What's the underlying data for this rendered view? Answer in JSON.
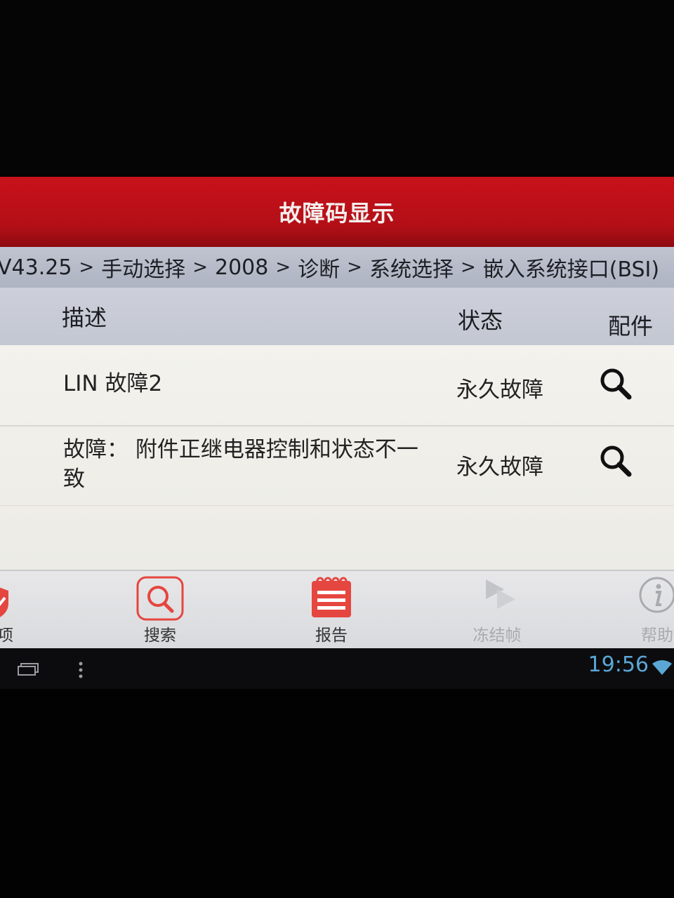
{
  "app": {
    "title": "故障码显示"
  },
  "breadcrumb": [
    "V43.25",
    "手动选择",
    "2008",
    "诊断",
    "系统选择",
    "嵌入系统接口(BSI)"
  ],
  "breadcrumb_separator": ">",
  "table": {
    "headers": {
      "description": "描述",
      "status": "状态",
      "part": "配件"
    },
    "rows": [
      {
        "description": "LIN 故障2",
        "status": "永久故障",
        "part_icon": "search-icon"
      },
      {
        "description": "故障： 附件正继电器控制和状态不一致",
        "status": "永久故障",
        "part_icon": "search-icon"
      }
    ]
  },
  "toolbar": {
    "partial_label": "项",
    "search_label": "搜索",
    "report_label": "报告",
    "freeze_frame_label": "冻结帧",
    "help_label": "帮助"
  },
  "system_bar": {
    "time": "19:56"
  },
  "colors": {
    "title_bar": "#b30f17",
    "accent_red": "#e5463f",
    "clock": "#5aa7d6",
    "disabled": "#a9aaae"
  }
}
